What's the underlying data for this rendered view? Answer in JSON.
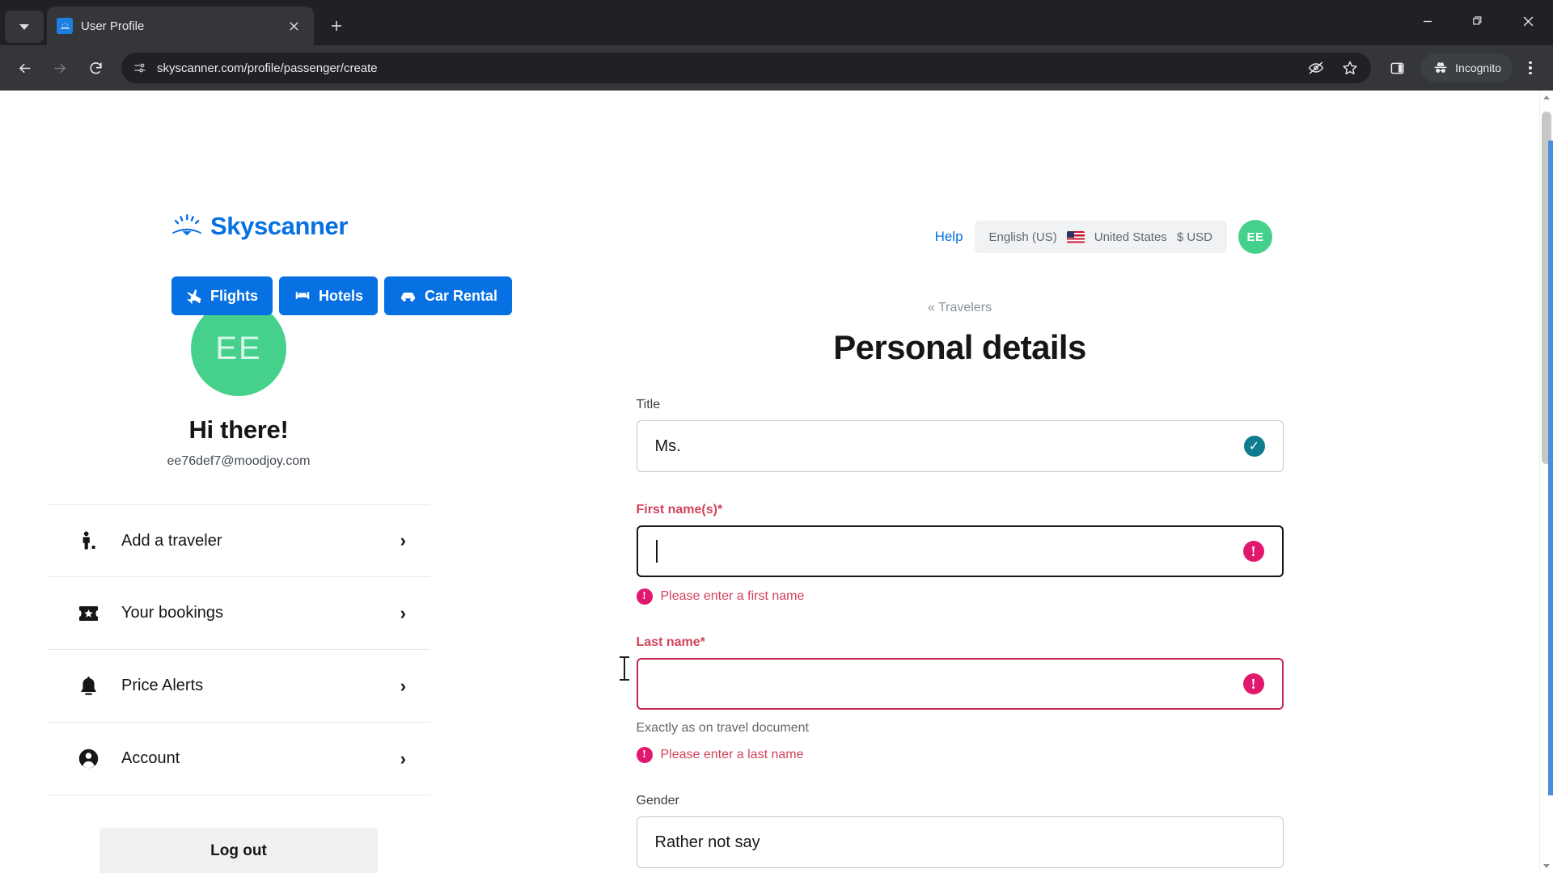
{
  "browser": {
    "tab": {
      "title": "User Profile",
      "favicon_icon": "skyscanner-favicon",
      "close_icon": "close-icon"
    },
    "tab_search_icon": "chevron-down-icon",
    "new_tab_label": "+",
    "window_controls": {
      "minimize": "minimize-icon",
      "maximize": "maximize-icon",
      "close": "close-icon"
    },
    "nav": {
      "back_icon": "arrow-left-icon",
      "forward_icon": "arrow-right-icon",
      "reload_icon": "reload-icon"
    },
    "omnibox": {
      "site_info_icon": "page-info-icon",
      "url": "skyscanner.com/profile/passenger/create",
      "tracking_icon": "eye-slash-icon",
      "bookmark_icon": "star-icon"
    },
    "side_panel_icon": "side-panel-icon",
    "incognito": {
      "label": "Incognito",
      "icon": "incognito-hat-icon"
    },
    "menu_icon": "three-dot-menu-icon"
  },
  "site": {
    "logo": {
      "text": "Skyscanner",
      "icon": "sunrise-rays-icon",
      "color": "#0770e3"
    },
    "nav_buttons": [
      {
        "label": "Flights",
        "icon": "airplane-icon"
      },
      {
        "label": "Hotels",
        "icon": "bed-icon"
      },
      {
        "label": "Car Rental",
        "icon": "car-icon"
      }
    ],
    "header_right": {
      "help_label": "Help",
      "locale": {
        "language": "English (US)",
        "flag_icon": "us-flag-icon",
        "country": "United States",
        "currency": "$ USD"
      },
      "avatar_initials": "EE"
    }
  },
  "sidebar": {
    "avatar_initials": "EE",
    "greeting": "Hi there!",
    "email": "ee76def7@moodjoy.com",
    "items": [
      {
        "label": "Add a traveler",
        "icon": "person-add-icon",
        "chevron": "›"
      },
      {
        "label": "Your bookings",
        "icon": "ticket-icon",
        "chevron": "›"
      },
      {
        "label": "Price Alerts",
        "icon": "bell-icon",
        "chevron": "›"
      },
      {
        "label": "Account",
        "icon": "account-circle-icon",
        "chevron": "›"
      }
    ],
    "logout_label": "Log out"
  },
  "main": {
    "breadcrumb": "« Travelers",
    "title": "Personal details",
    "fields": {
      "title": {
        "label": "Title",
        "value": "Ms.",
        "state": "valid",
        "status_icon": "check-circle-icon"
      },
      "first_name": {
        "label": "First name(s)*",
        "value": "",
        "state": "error-focused",
        "status_icon": "error-circle-icon",
        "error": "Please enter a first name",
        "error_icon": "error-circle-icon"
      },
      "last_name": {
        "label": "Last name*",
        "value": "",
        "state": "error",
        "status_icon": "error-circle-icon",
        "hint": "Exactly as on travel document",
        "error": "Please enter a last name",
        "error_icon": "error-circle-icon"
      },
      "gender": {
        "label": "Gender",
        "value": "Rather not say",
        "state": "neutral"
      }
    }
  },
  "colors": {
    "brand_blue": "#0770e3",
    "avatar_green": "#45d18c",
    "error_pink": "#d1435b",
    "error_icon_pink": "#e0196e",
    "valid_teal": "#0f7d8f"
  }
}
